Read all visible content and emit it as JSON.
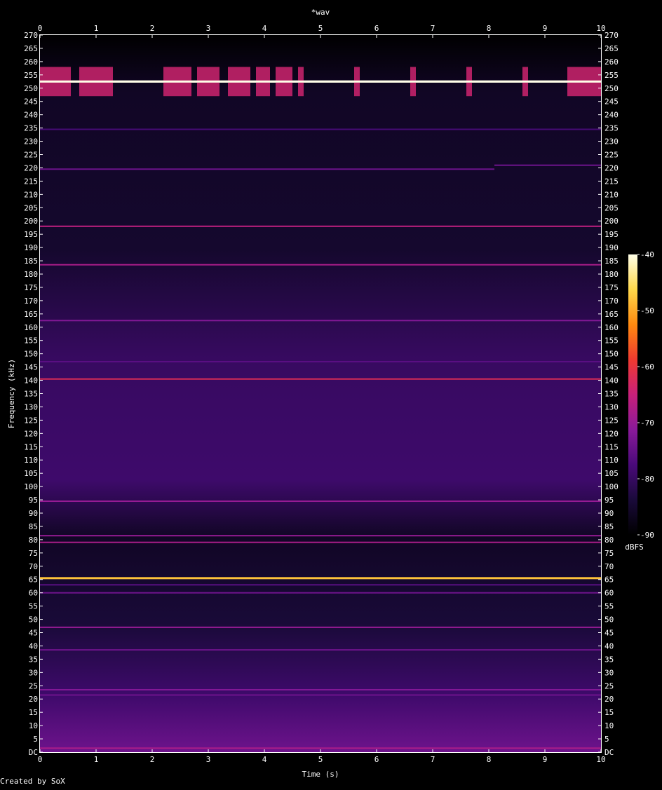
{
  "chart_data": {
    "type": "heatmap",
    "title": "*wav",
    "xlabel": "Time (s)",
    "ylabel": "Frequency (kHz)",
    "xlim": [
      0,
      10
    ],
    "ylim": [
      0,
      270
    ],
    "x_ticks": [
      "0",
      "1",
      "2",
      "3",
      "4",
      "5",
      "6",
      "7",
      "8",
      "9",
      "10"
    ],
    "y_ticks": [
      "DC",
      "5",
      "10",
      "15",
      "20",
      "25",
      "30",
      "35",
      "40",
      "45",
      "50",
      "55",
      "60",
      "65",
      "70",
      "75",
      "80",
      "85",
      "90",
      "95",
      "100",
      "105",
      "110",
      "115",
      "120",
      "125",
      "130",
      "135",
      "140",
      "145",
      "150",
      "155",
      "160",
      "165",
      "170",
      "175",
      "180",
      "185",
      "190",
      "195",
      "200",
      "205",
      "210",
      "215",
      "220",
      "225",
      "230",
      "235",
      "240",
      "245",
      "250",
      "255",
      "260",
      "265",
      "270"
    ],
    "colorbar": {
      "label": "dBFS",
      "range": [
        -90,
        -40
      ],
      "ticks": [
        "-40",
        "-50",
        "-60",
        "-70",
        "-80",
        "-90"
      ],
      "colors": [
        "#000000",
        "#1a0a3a",
        "#4a0a7a",
        "#8a1a9a",
        "#c8207a",
        "#f03a30",
        "#ff8a10",
        "#ffd84a",
        "#ffffe8"
      ]
    },
    "spectral_lines": [
      {
        "freq_khz": 252.5,
        "level_dbfs": -40,
        "t_start": 0,
        "t_end": 10
      },
      {
        "freq_khz": 234.5,
        "level_dbfs": -78,
        "t_start": 0,
        "t_end": 10
      },
      {
        "freq_khz": 219.5,
        "level_dbfs": -74,
        "t_start": 0,
        "t_end": 8.1
      },
      {
        "freq_khz": 221,
        "level_dbfs": -74,
        "t_start": 8.1,
        "t_end": 10
      },
      {
        "freq_khz": 198,
        "level_dbfs": -66,
        "t_start": 0,
        "t_end": 10
      },
      {
        "freq_khz": 183.5,
        "level_dbfs": -68,
        "t_start": 0,
        "t_end": 10
      },
      {
        "freq_khz": 162.5,
        "level_dbfs": -72,
        "t_start": 0,
        "t_end": 10
      },
      {
        "freq_khz": 147,
        "level_dbfs": -76,
        "t_start": 0,
        "t_end": 10
      },
      {
        "freq_khz": 140.5,
        "level_dbfs": -62,
        "t_start": 0,
        "t_end": 10
      },
      {
        "freq_khz": 94.5,
        "level_dbfs": -70,
        "t_start": 0,
        "t_end": 10
      },
      {
        "freq_khz": 81.5,
        "level_dbfs": -70,
        "t_start": 0,
        "t_end": 10
      },
      {
        "freq_khz": 79,
        "level_dbfs": -68,
        "t_start": 0,
        "t_end": 10
      },
      {
        "freq_khz": 65.5,
        "level_dbfs": -48,
        "t_start": 0,
        "t_end": 10
      },
      {
        "freq_khz": 63,
        "level_dbfs": -76,
        "t_start": 0,
        "t_end": 10
      },
      {
        "freq_khz": 60,
        "level_dbfs": -74,
        "t_start": 0,
        "t_end": 10
      },
      {
        "freq_khz": 47,
        "level_dbfs": -70,
        "t_start": 0,
        "t_end": 10
      },
      {
        "freq_khz": 38.5,
        "level_dbfs": -74,
        "t_start": 0,
        "t_end": 10
      },
      {
        "freq_khz": 23.5,
        "level_dbfs": -72,
        "t_start": 0,
        "t_end": 10
      },
      {
        "freq_khz": 21.5,
        "level_dbfs": -74,
        "t_start": 0,
        "t_end": 10
      },
      {
        "freq_khz": 1.5,
        "level_dbfs": -68,
        "t_start": 0,
        "t_end": 10
      }
    ],
    "bursts": {
      "freq_range_khz": [
        247,
        258
      ],
      "intervals_s": [
        [
          0.0,
          0.55
        ],
        [
          0.7,
          1.3
        ],
        [
          2.2,
          2.7
        ],
        [
          2.8,
          3.2
        ],
        [
          3.35,
          3.75
        ],
        [
          3.85,
          4.1
        ],
        [
          4.2,
          4.5
        ],
        [
          4.6,
          4.7
        ],
        [
          5.6,
          5.7
        ],
        [
          6.6,
          6.7
        ],
        [
          7.6,
          7.7
        ],
        [
          8.6,
          8.7
        ],
        [
          9.4,
          10.0
        ]
      ]
    }
  },
  "footer": {
    "credit": "Created by SoX"
  }
}
